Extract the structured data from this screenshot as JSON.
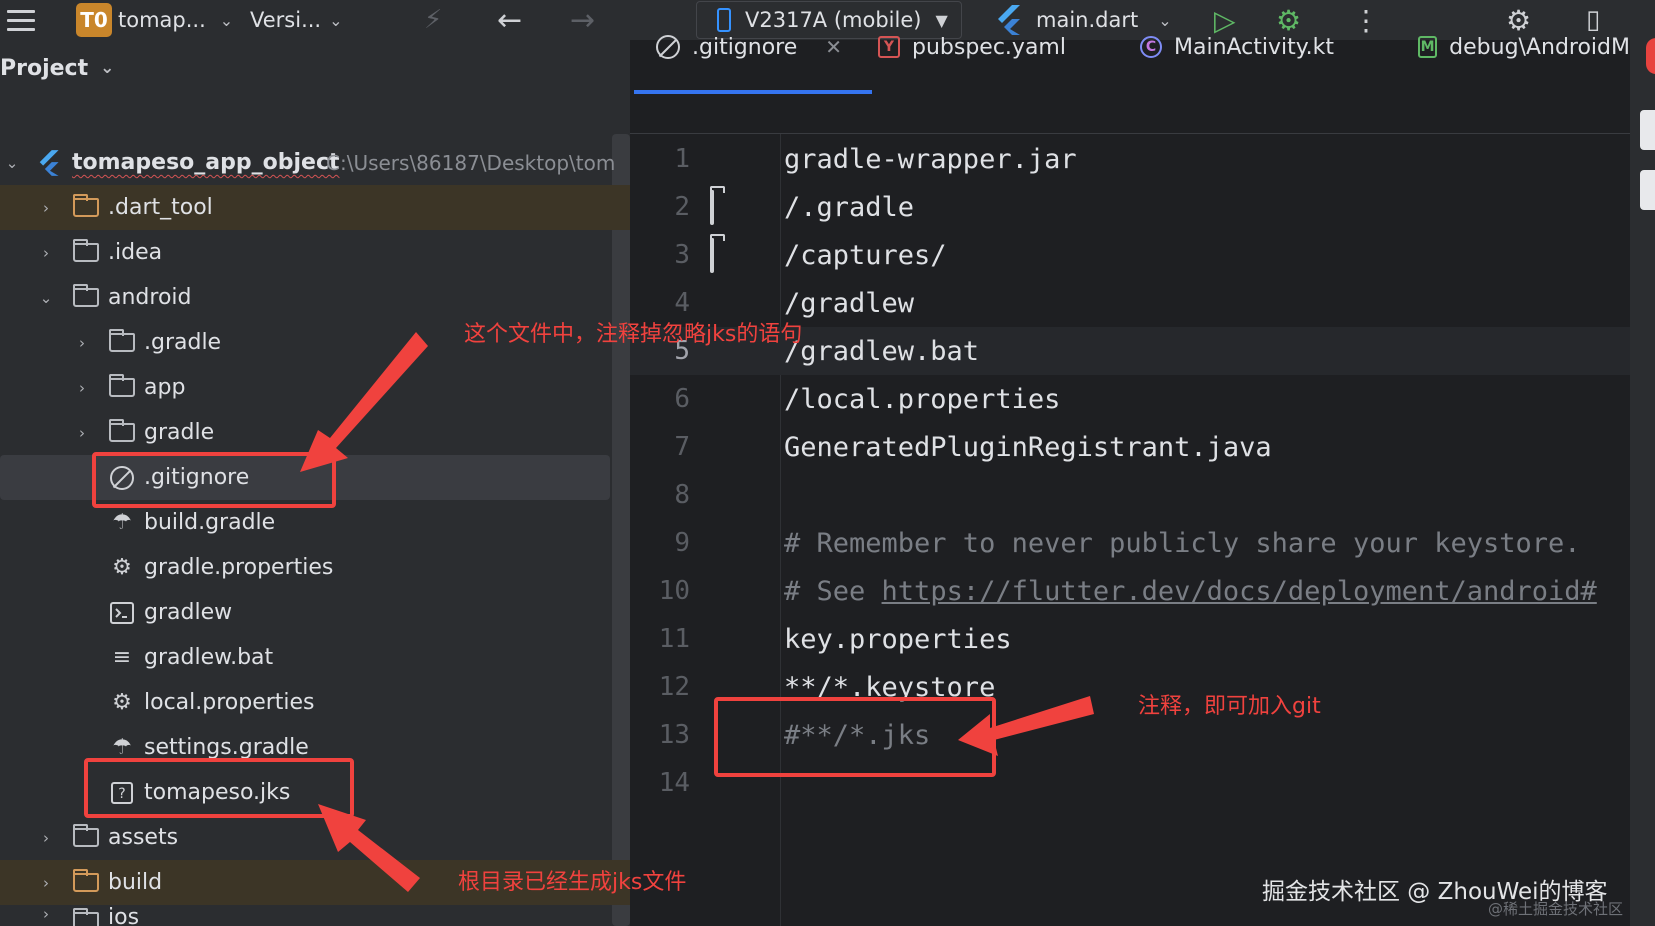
{
  "toolbar": {
    "project_badge": "T0",
    "project_name": "tomap...",
    "vcs_label": "Versi...",
    "device_label": "V2317A (mobile)",
    "run_config": "main.dart"
  },
  "project_panel": {
    "title": "Project",
    "root_name": "tomapeso_app_object",
    "root_path": "C:\\Users\\86187\\Desktop\\tom",
    "items": [
      {
        "label": ".dart_tool"
      },
      {
        "label": ".idea"
      },
      {
        "label": "android"
      },
      {
        "label": ".gradle"
      },
      {
        "label": "app"
      },
      {
        "label": "gradle"
      },
      {
        "label": ".gitignore"
      },
      {
        "label": "build.gradle"
      },
      {
        "label": "gradle.properties"
      },
      {
        "label": "gradlew"
      },
      {
        "label": "gradlew.bat"
      },
      {
        "label": "local.properties"
      },
      {
        "label": "settings.gradle"
      },
      {
        "label": "tomapeso.jks"
      },
      {
        "label": "assets"
      },
      {
        "label": "build"
      },
      {
        "label": "ios"
      }
    ]
  },
  "editor": {
    "tabs": [
      {
        "label": ".gitignore"
      },
      {
        "label": "pubspec.yaml"
      },
      {
        "label": "MainActivity.kt"
      },
      {
        "label": "debug\\AndroidM"
      }
    ],
    "lines": [
      {
        "num": "1",
        "text": "gradle-wrapper.jar"
      },
      {
        "num": "2",
        "text": "/.gradle"
      },
      {
        "num": "3",
        "text": "/captures/"
      },
      {
        "num": "4",
        "text": "/gradlew"
      },
      {
        "num": "5",
        "text": "/gradlew.bat"
      },
      {
        "num": "6",
        "text": "/local.properties"
      },
      {
        "num": "7",
        "text": "GeneratedPluginRegistrant.java"
      },
      {
        "num": "8",
        "text": ""
      },
      {
        "num": "9",
        "text": "# Remember to never publicly share your keystore."
      },
      {
        "num": "10",
        "text": "# See ",
        "link": "https://flutter.dev/docs/deployment/android#"
      },
      {
        "num": "11",
        "text": "key.properties"
      },
      {
        "num": "12",
        "text": "**/*.keystore"
      },
      {
        "num": "13",
        "text": "#**/*.jks"
      },
      {
        "num": "14",
        "text": ""
      }
    ]
  },
  "annotations": {
    "note1": "这个文件中，注释掉忽略jks的语句",
    "note2": "注释，即可加入git",
    "note3": "根目录已经生成jks文件"
  },
  "watermark": {
    "main": "掘金技术社区 @ ZhouWei的博客",
    "sub": "@稀土掘金技术社区"
  },
  "colors": {
    "accent": "#3574f0",
    "annotation_red": "#f0423e",
    "excluded_bg": "#3c3526"
  }
}
